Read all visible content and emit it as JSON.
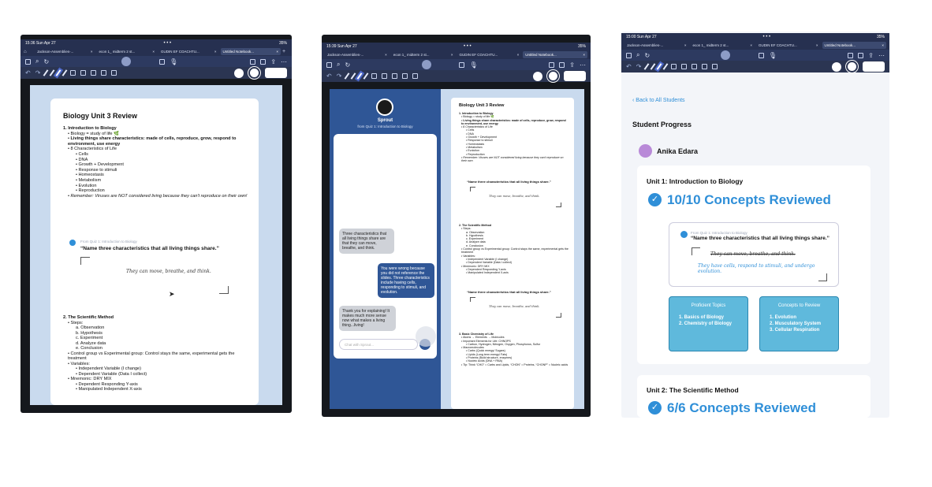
{
  "tablet1": {
    "status_time": "15:36  Sun Apr 27",
    "status_right": "35%",
    "tabs": [
      {
        "label": "Jackson-Assemblies-..."
      },
      {
        "label": "econ 1_ midterm 2 st..."
      },
      {
        "label": "GUDIN EF COACHTU..."
      },
      {
        "label": "Untitled Notebook..."
      }
    ],
    "doc": {
      "title": "Biology Unit 3 Review",
      "s1_heading": "1. Introduction to Biology",
      "s1_items": [
        "Biology = study of life 🌿",
        "Living things share characteristics: made of cells, reproduce, grow, respond to environment, use energy",
        "8 Characteristics of Life"
      ],
      "s1_sub": [
        "Cells",
        "DNA",
        "Growth + Development",
        "Response to stimuli",
        "Homeostasis",
        "Metabolism",
        "Evolution",
        "Reproduction"
      ],
      "s1_remember": "Remember: Viruses are NOT considered living because they can't reproduce on their own!",
      "quiz_from": "From Quiz 1: Introduction to Biology",
      "quiz_q": "“Name three characteristics that all living things share.”",
      "quiz_answer": "They can move, breathe, and think.",
      "s2_heading": "2. The Scientific Method",
      "s2_steps_label": "Steps:",
      "s2_steps": [
        "a. Observation",
        "b. Hypothesis",
        "c. Experiment",
        "d. Analyze data",
        "e. Conclusion"
      ],
      "s2_control": "Control group vs Experimental group: Control stays the same, experimental gets the treatment",
      "s2_variables_label": "Variables:",
      "s2_variables": [
        "Independent Variable (I change)",
        "Dependent Variable (Data I collect)"
      ],
      "s2_mnemonic": "Mnemonic: DRY MIX",
      "s2_mnemonic_sub": [
        "Dependent Responding Y-axis",
        "Manipulated Independent X-axis"
      ]
    }
  },
  "tablet2": {
    "status_time": "15:39  Sun Apr 27",
    "status_right": "35%",
    "tabs": [
      {
        "label": "Jackson-Assemblies-..."
      },
      {
        "label": "econ 1_ midterm 2 st..."
      },
      {
        "label": "GUDIN EF COACHTU..."
      },
      {
        "label": "Untitled Notebook..."
      }
    ],
    "chat": {
      "bot_name": "Sprout",
      "bot_sub": "from Quiz 1: Introduction to Biology",
      "messages": [
        {
          "from": "bot",
          "text": "Three characteristics that all living things share are that they can move, breathe, and think."
        },
        {
          "from": "user",
          "text": "You were wrong because you did not reference the slides. Three characteristics include having cells, responding to stimuli, and evolution."
        },
        {
          "from": "bot",
          "text": "Thank you for explaining! It makes much more sense now what makes a living thing...living!"
        }
      ],
      "input_placeholder": "Chat with Sprout..."
    },
    "doc": {
      "title": "Biology Unit 3 Review",
      "s1_heading": "1. Introduction to Biology",
      "s1_lines": [
        "Biology = study of life 🌿",
        "Living things share characteristics: made of cells, reproduce, grow, respond to environment, use energy",
        "8 Characteristics of Life",
        "Cells",
        "DNA",
        "Growth + Development",
        "Response to stimuli",
        "Homeostasis",
        "Metabolism",
        "Evolution",
        "Reproduction",
        "Remember: Viruses are NOT considered living because they can't reproduce on their own"
      ],
      "quiz1_q": "“Name three characteristics that all living things share.”",
      "quiz1_a": "They can move, breathe, and think.",
      "s2_heading": "2. The Scientific Method",
      "s2_lines": [
        "Steps:",
        "a. Observation",
        "b. Hypothesis",
        "c. Experiment",
        "d. Analyze data",
        "e. Conclusion",
        "Control group vs Experimental group: Control stays the same, experimental gets the treatment",
        "Variables:",
        "Independent Variable (I change)",
        "Dependent Variable (Data I collect)",
        "Mnemonic: DRY MIX",
        "Dependent Responding Y-axis",
        "Manipulated Independent X-axis"
      ],
      "quiz2_q": "“Name three characteristics that all living things share.”",
      "quiz2_a": "They can move, breathe, and think.",
      "s3_heading": "3. Basic Chemistry of Life",
      "s3_lines": [
        "Atoms → Elements → Molecules",
        "Important Elements for Life: CHNOPS",
        "Carbon, Hydrogen, Nitrogen, Oxygen, Phosphorus, Sulfur",
        "Macromolecules:",
        "Carbs (Quick energy/ Sugars)",
        "Lipids (Long term energy/ Fats)",
        "Proteins (Build structure, enzymes)",
        "Nucleic Acids (DNA + RNA)",
        "Tip: Think “CHO” = Carbs and Lipids, “CHON” = Proteins, “CHONP” = Nucleic acids"
      ]
    }
  },
  "tablet3": {
    "status_time": "15:00  Sun Apr 27",
    "status_right": "35%",
    "tabs": [
      {
        "label": "Jackson-Assemblies-..."
      },
      {
        "label": "econ 1_ midterm 2 st..."
      },
      {
        "label": "GUDIN EF COACHTU..."
      },
      {
        "label": "Untitled Notebook..."
      }
    ],
    "back_link": "Back to All Students",
    "page_title": "Student Progress",
    "student_name": "Anika Edara",
    "unit1": {
      "title": "Unit 1: Introduction to Biology",
      "reviewed": "10/10 Concepts Reviewed",
      "quiz_from": "From Quiz 1: Introduction to Biology",
      "quiz_q": "“Name three characteristics that all living things share.”",
      "quiz_struck": "They can move, breathe, and think.",
      "quiz_corrected": "They have cells, respond to stimuli, and undergo evolution.",
      "proficient_title": "Proficient Topics",
      "proficient": [
        "1. Basics of Biology",
        "2. Chemistry of Biology"
      ],
      "review_title": "Concepts to Review",
      "review": [
        "1. Evolution",
        "2. Musculatory System",
        "3. Cellular Respiration"
      ]
    },
    "unit2": {
      "title": "Unit 2: The Scientific Method",
      "reviewed": "6/6 Concepts Reviewed"
    }
  },
  "colors": {
    "accent_blue": "#2f8fd8",
    "toolbar": "#2b3552",
    "chat_blue": "#2f5696",
    "topic_box": "#5fb9dc"
  }
}
